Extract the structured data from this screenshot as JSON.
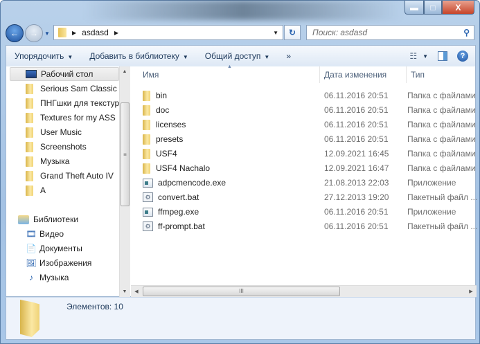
{
  "window": {
    "controls": [
      "minimize",
      "maximize",
      "close"
    ]
  },
  "address": {
    "path": "asdasd",
    "search_placeholder": "Поиск: asdasd"
  },
  "toolbar": {
    "organize": "Упорядочить",
    "add_library": "Добавить в библиотеку",
    "share": "Общий доступ",
    "more": "»"
  },
  "nav": {
    "desktop": "Рабочий стол",
    "folders": [
      "Serious Sam Classic T",
      "ПНГшки для текстур",
      "Textures for my ASS",
      "User Music",
      "Screenshots",
      "Музыка",
      "Grand Theft Auto IV",
      "A"
    ],
    "libraries": "Библиотеки",
    "lib_items": [
      {
        "label": "Видео",
        "icon": "video-icon"
      },
      {
        "label": "Документы",
        "icon": "documents-icon"
      },
      {
        "label": "Изображения",
        "icon": "images-icon"
      },
      {
        "label": "Музыка",
        "icon": "music-icon"
      }
    ]
  },
  "columns": {
    "name": "Имя",
    "date": "Дата изменения",
    "type": "Тип"
  },
  "files": [
    {
      "name": "bin",
      "date": "06.11.2016 20:51",
      "type": "Папка с файлами",
      "icon": "folder"
    },
    {
      "name": "doc",
      "date": "06.11.2016 20:51",
      "type": "Папка с файлами",
      "icon": "folder"
    },
    {
      "name": "licenses",
      "date": "06.11.2016 20:51",
      "type": "Папка с файлами",
      "icon": "folder"
    },
    {
      "name": "presets",
      "date": "06.11.2016 20:51",
      "type": "Папка с файлами",
      "icon": "folder"
    },
    {
      "name": "USF4",
      "date": "12.09.2021 16:45",
      "type": "Папка с файлами",
      "icon": "folder"
    },
    {
      "name": "USF4 Nachalo",
      "date": "12.09.2021 16:47",
      "type": "Папка с файлами",
      "icon": "folder"
    },
    {
      "name": "adpcmencode.exe",
      "date": "21.08.2013 22:03",
      "type": "Приложение",
      "icon": "exe"
    },
    {
      "name": "convert.bat",
      "date": "27.12.2013 19:20",
      "type": "Пакетный файл ...",
      "icon": "bat"
    },
    {
      "name": "ffmpeg.exe",
      "date": "06.11.2016 20:51",
      "type": "Приложение",
      "icon": "exe"
    },
    {
      "name": "ff-prompt.bat",
      "date": "06.11.2016 20:51",
      "type": "Пакетный файл ...",
      "icon": "bat"
    }
  ],
  "status": {
    "count": "Элементов: 10"
  }
}
